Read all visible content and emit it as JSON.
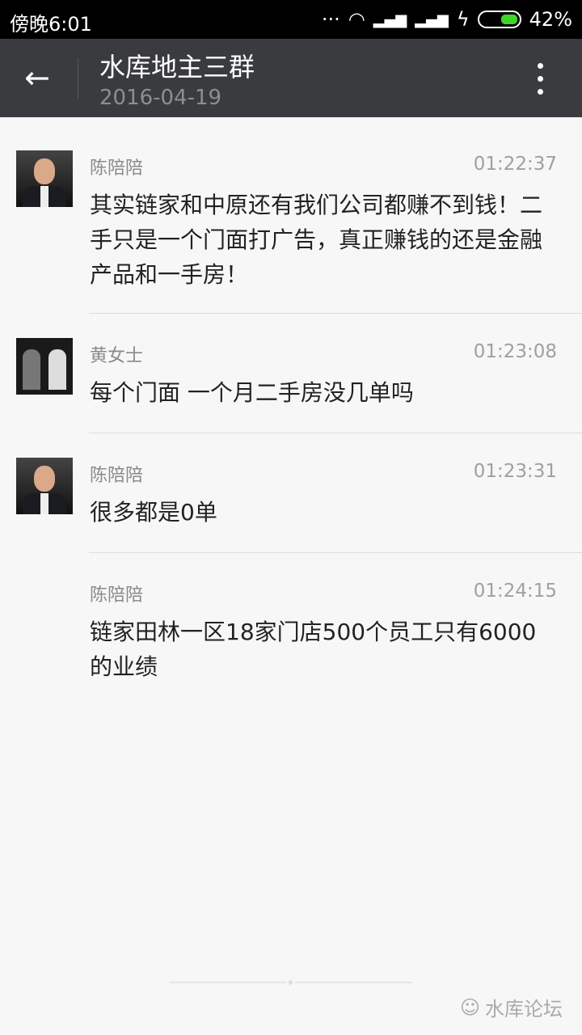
{
  "status_bar": {
    "time": "傍晚6:01",
    "battery": "42%",
    "battery_level": 0.42
  },
  "toolbar": {
    "title": "水库地主三群",
    "date": "2016-04-19"
  },
  "messages": [
    {
      "sender": "陈陪陪",
      "time": "01:22:37",
      "text": "其实链家和中原还有我们公司都赚不到钱！二手只是一个门面打广告，真正赚钱的还是金融产品和一手房！"
    },
    {
      "sender": "黄女士",
      "time": "01:23:08",
      "text": "每个门面 一个月二手房没几单吗"
    },
    {
      "sender": "陈陪陪",
      "time": "01:23:31",
      "text": "很多都是0单"
    },
    {
      "sender": "陈陪陪",
      "time": "01:24:15",
      "text": "链家田林一区18家门店500个员工只有6000的业绩"
    }
  ],
  "watermark": "水库论坛"
}
